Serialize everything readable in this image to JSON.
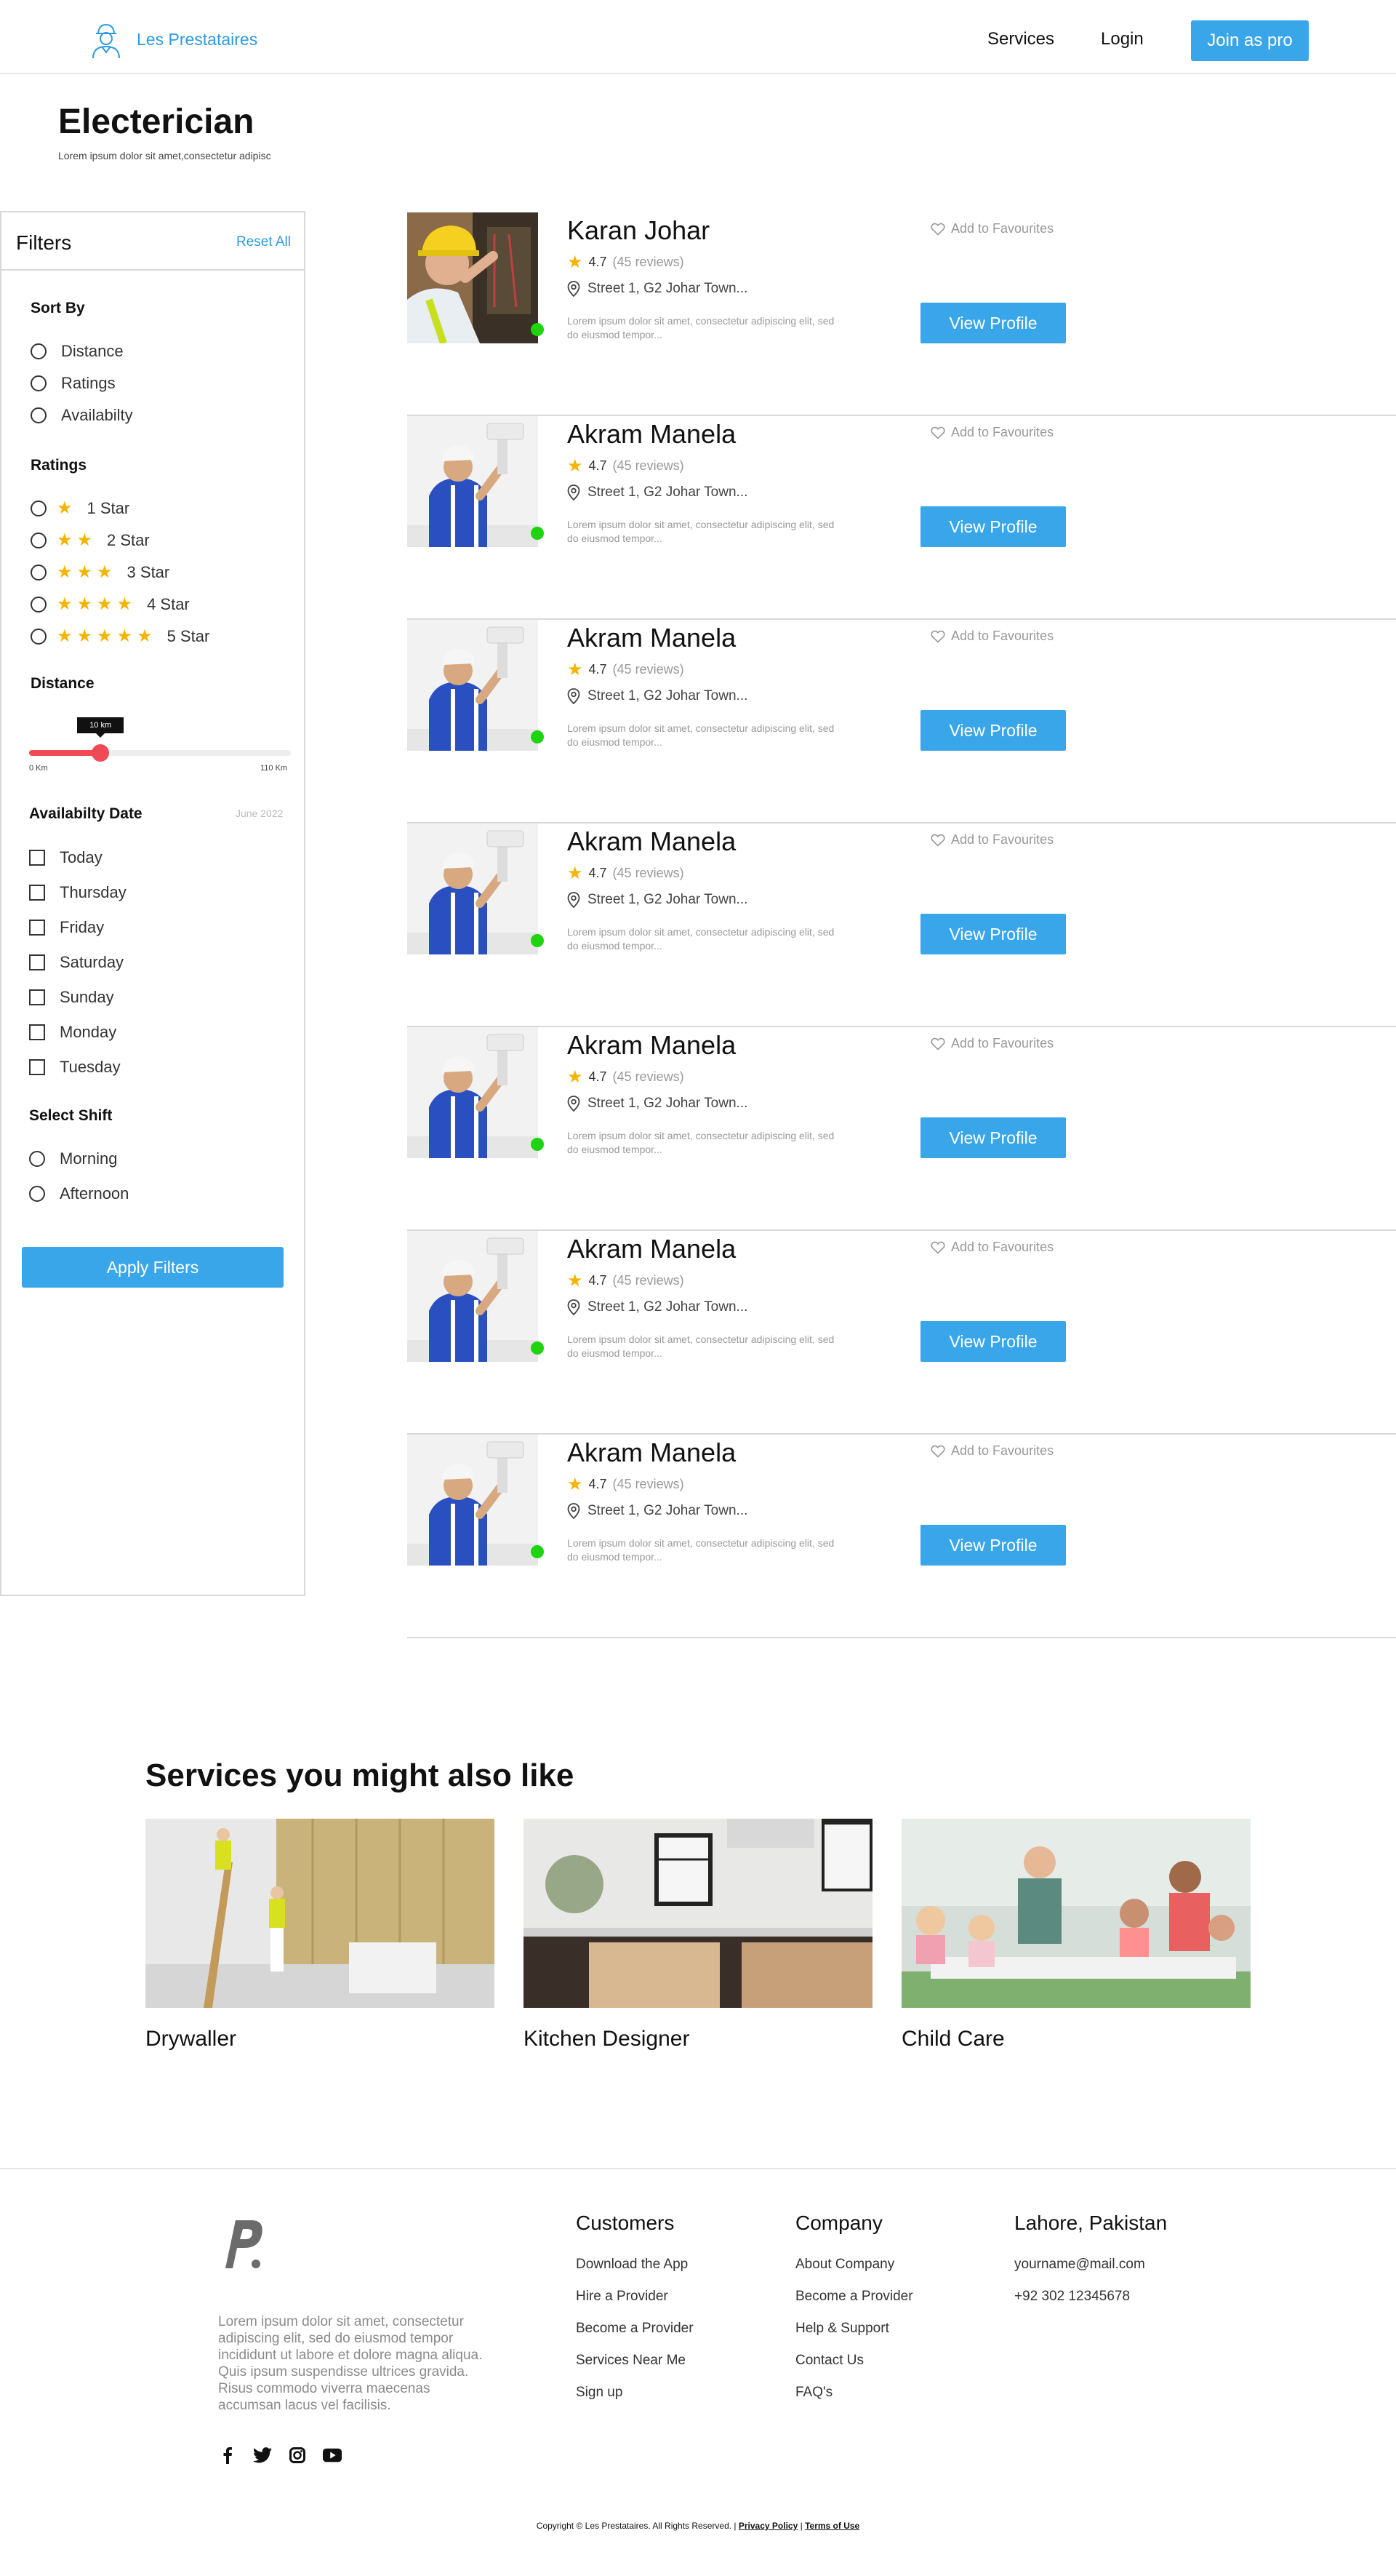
{
  "nav": {
    "brand": "Les Prestataires",
    "services_label": "Services",
    "login_label": "Login",
    "join_label": "Join as pro"
  },
  "header": {
    "title": "Electerician",
    "subtitle": "Lorem ipsum dolor sit amet,consectetur adipisc"
  },
  "filters": {
    "title": "Filters",
    "reset_label": "Reset All",
    "sort_title": "Sort By",
    "sort_options": [
      "Distance",
      "Ratings",
      "Availabilty"
    ],
    "ratings_title": "Ratings",
    "rating_options": [
      {
        "stars": "★",
        "label": "1 Star"
      },
      {
        "stars": "★★",
        "label": "2 Star"
      },
      {
        "stars": "★★★",
        "label": "3 Star"
      },
      {
        "stars": "★★★★",
        "label": "4 Star"
      },
      {
        "stars": "★★★★★",
        "label": "5 Star"
      }
    ],
    "distance_title": "Distance",
    "distance_value_label": "10 km",
    "distance_min_label": "0 Km",
    "distance_max_label": "110 Km",
    "distance_min": 0,
    "distance_max": 110,
    "distance_value": 30,
    "date_title": "Availabilty Date",
    "date_hint": "June 2022",
    "date_options": [
      "Today",
      "Thursday",
      "Friday",
      "Saturday",
      "Sunday",
      "Monday",
      "Tuesday"
    ],
    "shift_title": "Select Shift",
    "shift_options": [
      "Morning",
      "Afternoon"
    ],
    "apply_label": "Apply Filters"
  },
  "listings": [
    {
      "name": "Karan Johar",
      "rating": "4.7",
      "reviews": "(45 reviews)",
      "address": "Street 1, G2 Johar Town...",
      "description": "Lorem ipsum dolor sit amet, consectetur adipiscing elit, sed do eiusmod tempor...",
      "favourite_label": "Add to Favourites",
      "button_label": "View Profile",
      "photo": "electrician"
    },
    {
      "name": "Akram Manela",
      "rating": "4.7",
      "reviews": "(45 reviews)",
      "address": "Street 1, G2 Johar Town...",
      "description": "Lorem ipsum dolor sit amet, consectetur adipiscing elit, sed do eiusmod tempor...",
      "favourite_label": "Add to Favourites",
      "button_label": "View Profile",
      "photo": "painter"
    },
    {
      "name": "Akram Manela",
      "rating": "4.7",
      "reviews": "(45 reviews)",
      "address": "Street 1, G2 Johar Town...",
      "description": "Lorem ipsum dolor sit amet, consectetur adipiscing elit, sed do eiusmod tempor...",
      "favourite_label": "Add to Favourites",
      "button_label": "View Profile",
      "photo": "painter"
    },
    {
      "name": "Akram Manela",
      "rating": "4.7",
      "reviews": "(45 reviews)",
      "address": "Street 1, G2 Johar Town...",
      "description": "Lorem ipsum dolor sit amet, consectetur adipiscing elit, sed do eiusmod tempor...",
      "favourite_label": "Add to Favourites",
      "button_label": "View Profile",
      "photo": "painter"
    },
    {
      "name": "Akram Manela",
      "rating": "4.7",
      "reviews": "(45 reviews)",
      "address": "Street 1, G2 Johar Town...",
      "description": "Lorem ipsum dolor sit amet, consectetur adipiscing elit, sed do eiusmod tempor...",
      "favourite_label": "Add to Favourites",
      "button_label": "View Profile",
      "photo": "painter"
    },
    {
      "name": "Akram Manela",
      "rating": "4.7",
      "reviews": "(45 reviews)",
      "address": "Street 1, G2 Johar Town...",
      "description": "Lorem ipsum dolor sit amet, consectetur adipiscing elit, sed do eiusmod tempor...",
      "favourite_label": "Add to Favourites",
      "button_label": "View Profile",
      "photo": "painter"
    },
    {
      "name": "Akram Manela",
      "rating": "4.7",
      "reviews": "(45 reviews)",
      "address": "Street 1, G2 Johar Town...",
      "description": "Lorem ipsum dolor sit amet, consectetur adipiscing elit, sed do eiusmod tempor...",
      "favourite_label": "Add to Favourites",
      "button_label": "View Profile",
      "photo": "painter"
    }
  ],
  "services": {
    "title": "Services you might also like",
    "items": [
      {
        "name": "Drywaller",
        "image": "drywall-workers"
      },
      {
        "name": "Kitchen Designer",
        "image": "kitchen-interior"
      },
      {
        "name": "Child Care",
        "image": "children-classroom"
      }
    ]
  },
  "footer": {
    "description": "Lorem ipsum dolor sit amet, consectetur adipiscing elit, sed do eiusmod tempor incididunt ut labore et dolore magna aliqua. Quis ipsum suspendisse ultrices gravida. Risus commodo viverra maecenas accumsan lacus vel facilisis.",
    "socials": [
      "facebook-icon",
      "twitter-icon",
      "instagram-icon",
      "youtube-icon"
    ],
    "customers": {
      "title": "Customers",
      "links": [
        "Download the App",
        "Hire a Provider",
        "Become a Provider",
        "Services Near Me",
        "Sign up"
      ]
    },
    "company": {
      "title": "Company",
      "links": [
        "About Company",
        "Become a Provider",
        "Help & Support",
        "Contact Us",
        "FAQ's"
      ]
    },
    "contact": {
      "title": "Lahore, Pakistan",
      "email": "yourname@mail.com",
      "phone": "+92 302 12345678"
    },
    "copyright_text": "Copyright © Les Prestataires. All Rights Reserved. |",
    "privacy_label": "Privacy Policy",
    "separator": "|",
    "terms_label": "Terms of Use"
  },
  "colors": {
    "accent": "#3aa6ea",
    "brand": "#2c9be0",
    "star": "#f5b400",
    "online": "#1ed40e",
    "slider": "#ef4a55"
  }
}
